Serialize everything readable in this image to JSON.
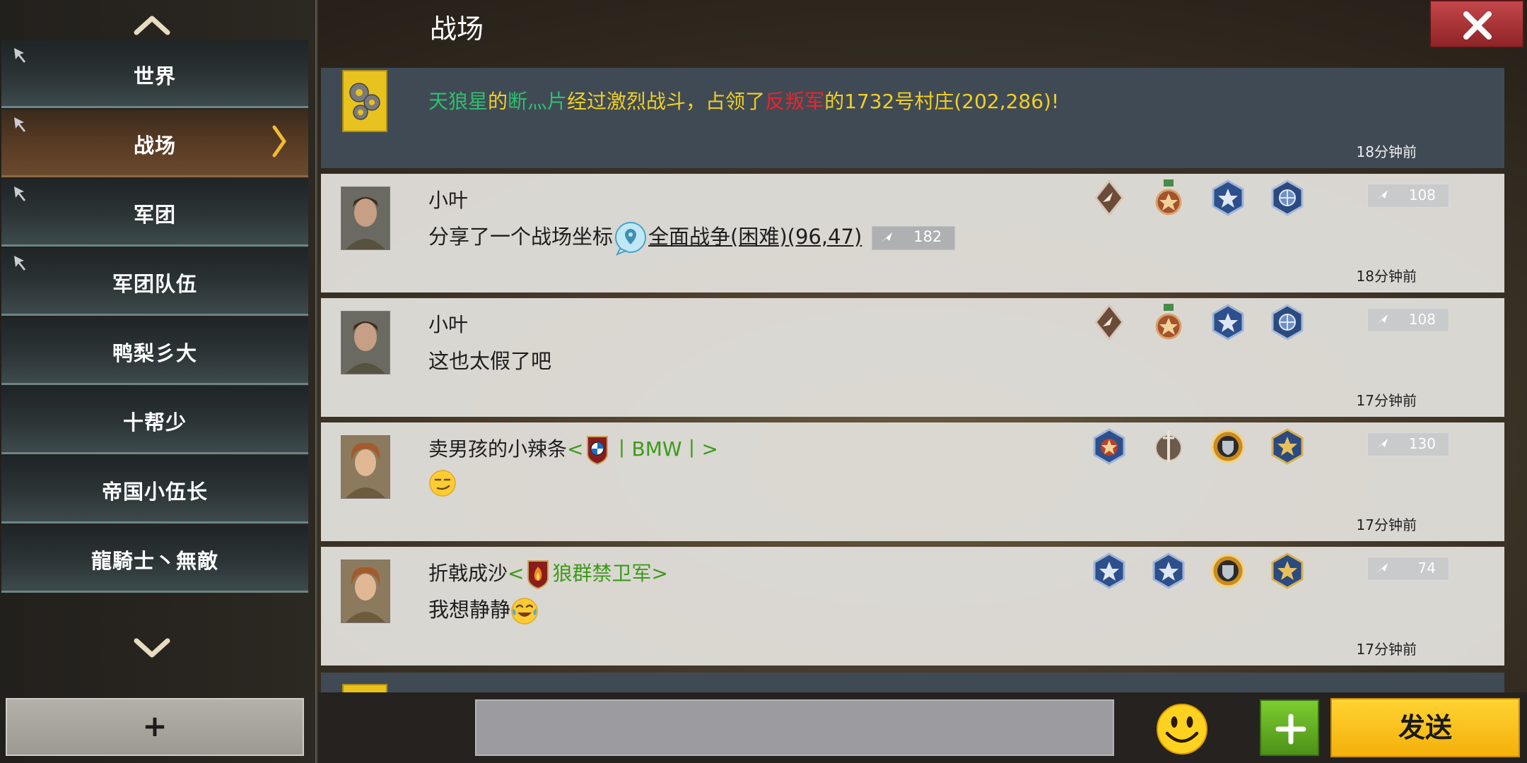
{
  "sidebar": {
    "channels": [
      {
        "label": "世界",
        "pinned": true,
        "active": false
      },
      {
        "label": "战场",
        "pinned": true,
        "active": true
      },
      {
        "label": "军团",
        "pinned": true,
        "active": false
      },
      {
        "label": "军团队伍",
        "pinned": true,
        "active": false
      },
      {
        "label": "鸭梨彡大",
        "pinned": false,
        "active": false
      },
      {
        "label": "十帮少",
        "pinned": false,
        "active": false
      },
      {
        "label": "帝国小伍长",
        "pinned": false,
        "active": false
      },
      {
        "label": "龍騎士丶無敵",
        "pinned": false,
        "active": false
      }
    ],
    "add_label": "+"
  },
  "header": {
    "title": "战场"
  },
  "messages": [
    {
      "type": "system",
      "parts": [
        "天狼星",
        "的",
        "断灬片",
        "经过激烈战斗，占领了",
        "反叛军",
        "的1732号村庄(202,286)!"
      ],
      "time": "18分钟前"
    },
    {
      "type": "chat",
      "sender": "小叶",
      "text": "分享了一个战场坐标",
      "link": "全面战争(困难)(96,47)",
      "link_power": "182",
      "power": "108",
      "medals": [
        "diamond-rank-medal",
        "bronze-star-medal",
        "blue-star-medal",
        "blue-eagle-medal"
      ],
      "time": "18分钟前"
    },
    {
      "type": "chat",
      "sender": "小叶",
      "text": "这也太假了吧",
      "power": "108",
      "medals": [
        "diamond-rank-medal",
        "bronze-star-medal",
        "blue-star-medal",
        "blue-eagle-medal"
      ],
      "time": "17分钟前"
    },
    {
      "type": "chat",
      "sender": "卖男孩的小辣条",
      "alliance_open": "<",
      "alliance_name": "丨BMW丨>",
      "text_emoji": "smirk",
      "power": "130",
      "medals": [
        "blue-star-medal",
        "sword-medal",
        "gold-shield-medal",
        "gold-eagle-medal"
      ],
      "time": "17分钟前"
    },
    {
      "type": "chat",
      "sender": "折戟成沙",
      "alliance_open": "<",
      "alliance_name": "狼群禁卫军>",
      "text": "我想静静",
      "text_emoji": "tears-of-joy",
      "power": "74",
      "medals": [
        "blue-star-medal",
        "blue-star-medal",
        "gold-shield-medal",
        "gold-eagle-medal"
      ],
      "time": "17分钟前"
    }
  ],
  "composer": {
    "input_value": "",
    "send_label": "发送",
    "more_label": "+"
  }
}
